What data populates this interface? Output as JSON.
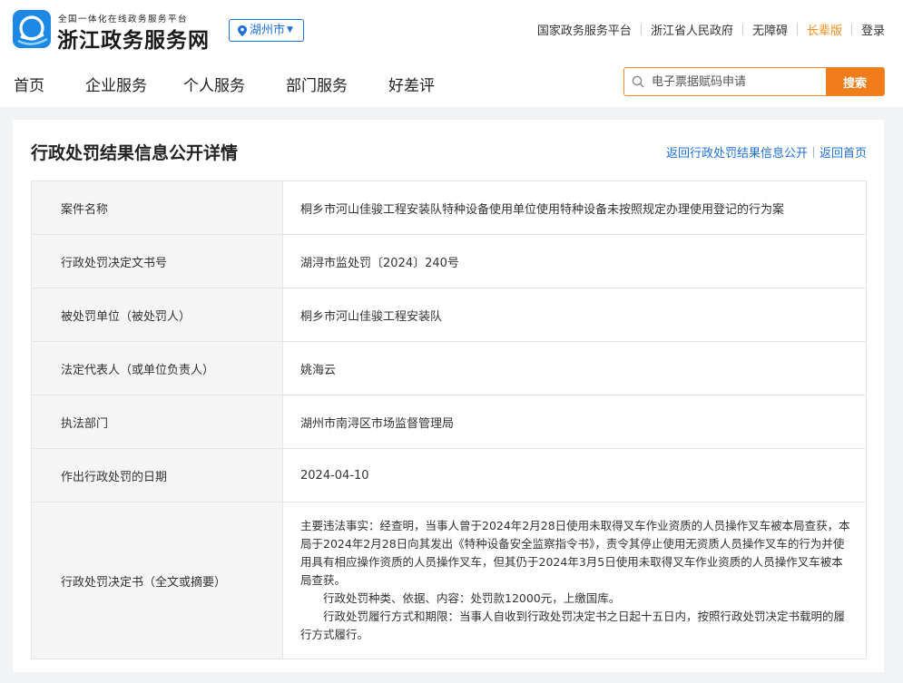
{
  "header": {
    "logo_subtitle": "全国一体化在线政务服务平台",
    "logo_title": "浙江政务服务网",
    "city": "湖州市",
    "top_links": [
      {
        "label": "国家政务服务平台"
      },
      {
        "label": "浙江省人民政府"
      },
      {
        "label": "无障碍"
      },
      {
        "label": "长辈版"
      },
      {
        "label": "登录"
      }
    ]
  },
  "nav": {
    "items": [
      "首页",
      "企业服务",
      "个人服务",
      "部门服务",
      "好差评"
    ]
  },
  "search": {
    "placeholder": "电子票据赋码申请",
    "button": "搜索"
  },
  "page": {
    "title": "行政处罚结果信息公开详情",
    "back_list": "返回行政处罚结果信息公开",
    "back_home": "返回首页"
  },
  "details": [
    {
      "label": "案件名称",
      "value": "桐乡市河山佳骏工程安装队特种设备使用单位使用特种设备未按照规定办理使用登记的行为案"
    },
    {
      "label": "行政处罚决定文书号",
      "value": "湖浔市监处罚〔2024〕240号"
    },
    {
      "label": "被处罚单位（被处罚人）",
      "value": "桐乡市河山佳骏工程安装队"
    },
    {
      "label": "法定代表人（或单位负责人）",
      "value": "姚海云"
    },
    {
      "label": "执法部门",
      "value": "湖州市南浔区市场监督管理局"
    },
    {
      "label": "作出行政处罚的日期",
      "value": "2024-04-10"
    }
  ],
  "decision": {
    "label": "行政处罚决定书（全文或摘要）",
    "paragraphs": [
      "主要违法事实：经查明，当事人曾于2024年2月28日使用未取得叉车作业资质的人员操作叉车被本局查获，本局于2024年2月28日向其发出《特种设备安全监察指令书》，责令其停止使用无资质人员操作叉车的行为并使用具有相应操作资质的人员操作叉车，但其仍于2024年3月5日使用未取得叉车作业资质的人员操作叉车被本局查获。",
      "行政处罚种类、依据、内容：处罚款12000元，上缴国库。",
      "行政处罚履行方式和期限：当事人自收到行政处罚决定书之日起十五日内，按照行政处罚决定书载明的履行方式履行。"
    ]
  },
  "colors": {
    "brand_blue": "#1e6fd9",
    "accent_orange": "#f07d1a"
  }
}
